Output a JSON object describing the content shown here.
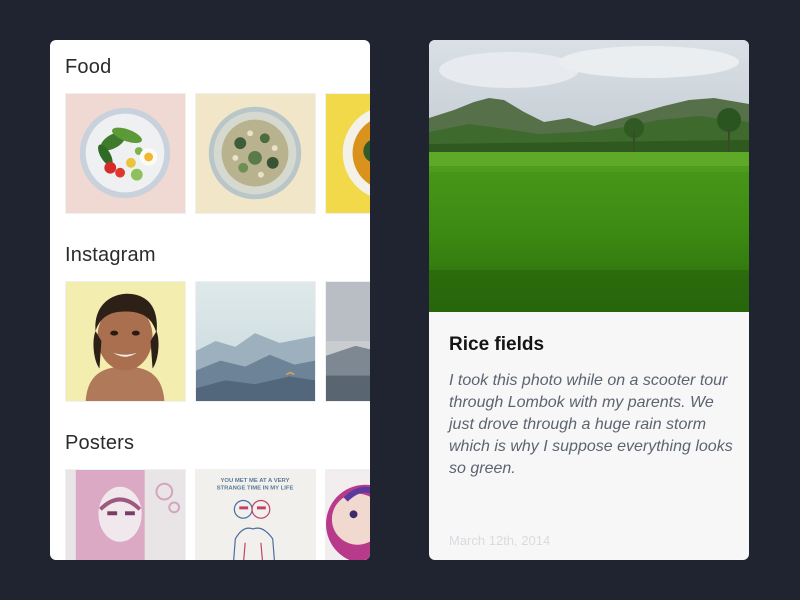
{
  "sections": [
    {
      "title": "Food"
    },
    {
      "title": "Instagram"
    },
    {
      "title": "Posters"
    }
  ],
  "post": {
    "title": "Rice fields",
    "body": "I took this photo while on a scooter tour through Lombok with my parents. We just drove through a huge rain storm which is why I suppose everything looks so green.",
    "date": "March 12th, 2014"
  },
  "poster_text": "YOU MET ME AT A VERY STRANGE TIME IN MY LIFE",
  "colors": {
    "background": "#1f2430",
    "card": "#ffffff",
    "detail_panel": "#f7f7f8"
  }
}
